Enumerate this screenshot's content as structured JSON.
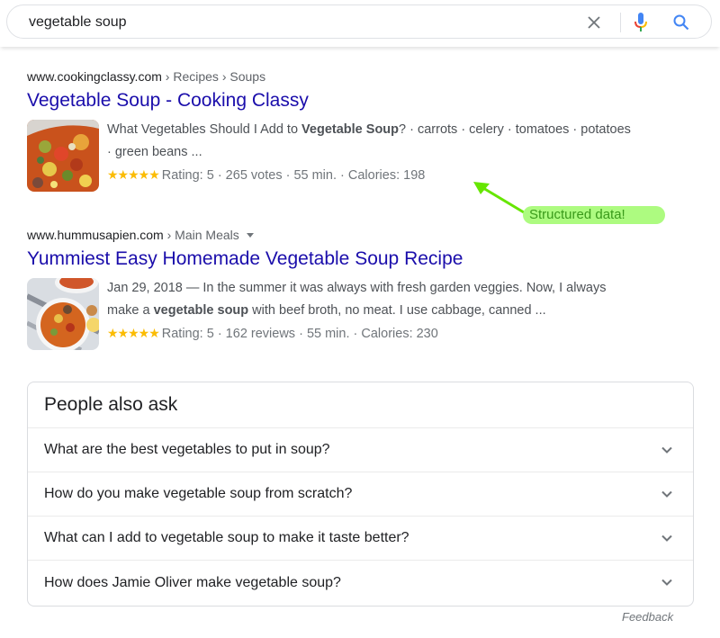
{
  "search": {
    "query": "vegetable soup",
    "clear_icon": "close-icon",
    "mic_icon": "microphone-icon",
    "search_icon": "magnifier-icon"
  },
  "results": [
    {
      "domain": "www.cookingclassy.com",
      "path": " › Recipes › Soups",
      "title": "Vegetable Soup - Cooking Classy",
      "snippet_pre": "What Vegetables Should I Add to ",
      "snippet_bold": "Vegetable Soup",
      "snippet_post": "? · carrots · celery · tomatoes · potatoes · green beans ...",
      "stars": "★★★★★",
      "rating_text": "Rating: 5 · 265 votes · 55 min. · Calories: 198",
      "thumbnail": "vegetable-soup-closeup-image"
    },
    {
      "domain": "www.hummusapien.com",
      "path": " › Main Meals",
      "title": "Yummiest Easy Homemade Vegetable Soup Recipe",
      "snippet_pre": "Jan 29, 2018 — In the summer it was always with fresh garden veggies. Now, I always make a ",
      "snippet_bold": "vegetable soup",
      "snippet_post": " with beef broth, no meat. I use cabbage, canned ...",
      "stars": "★★★★★",
      "rating_text": "Rating: 5 · 162 reviews · 55 min. · Calories: 230",
      "thumbnail": "vegetable-soup-bowl-image"
    }
  ],
  "annotation": {
    "label": "Structured data!",
    "color": "#adfb80",
    "arrow_color": "#66e600"
  },
  "people_also_ask": {
    "title": "People also ask",
    "questions": [
      "What are the best vegetables to put in soup?",
      "How do you make vegetable soup from scratch?",
      "What can I add to vegetable soup to make it taste better?",
      "How does Jamie Oliver make vegetable soup?"
    ]
  },
  "feedback_label": "Feedback",
  "colors": {
    "link": "#1a0dab",
    "star": "#fbbc04",
    "text": "#4d5156"
  }
}
